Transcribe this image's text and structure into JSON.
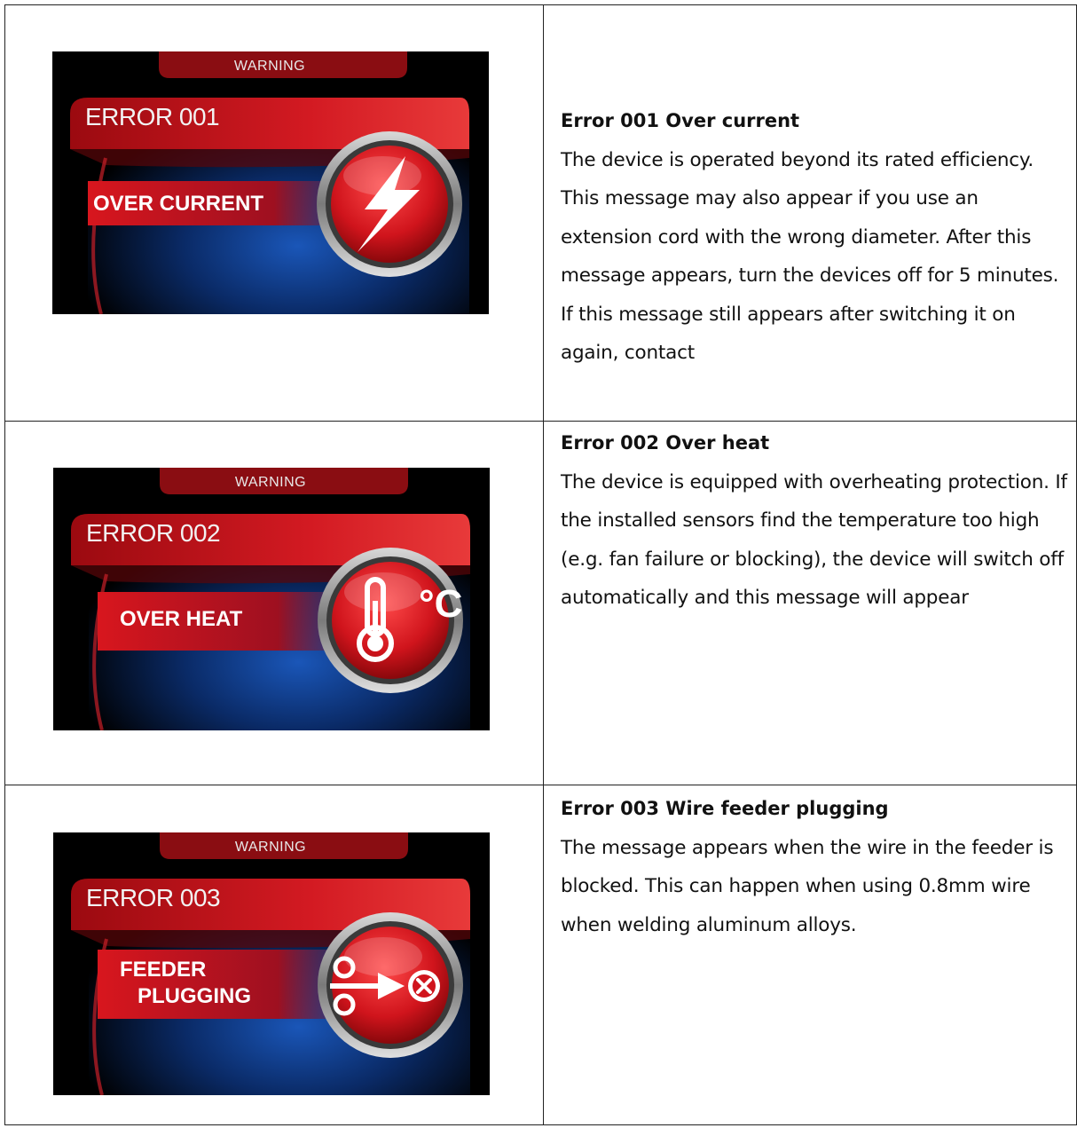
{
  "errors": [
    {
      "warning": "WARNING",
      "code": "ERROR 001",
      "name_lines": [
        "OVER CURRENT"
      ],
      "icon": "lightning-bolt-icon",
      "title": "Error 001 Over current",
      "description": "The device is operated beyond its rated efficiency. This message may also appear if you use an extension cord with the wrong diameter. After this message appears, turn the devices off for 5 minutes. If this message still appears after switching it on again, contact"
    },
    {
      "warning": "WARNING",
      "code": "ERROR 002",
      "name_lines": [
        "OVER HEAT"
      ],
      "icon": "thermometer-celsius-icon",
      "icon_text": "°C",
      "title": "Error 002 Over heat",
      "description": "The device is equipped with overheating protection. If the installed sensors find the temperature too high (e.g. fan failure or blocking), the device will switch off automatically and this message will appear"
    },
    {
      "warning": "WARNING",
      "code": "ERROR 003",
      "name_lines": [
        "FEEDER",
        "PLUGGING"
      ],
      "icon": "feeder-blocked-icon",
      "title": "Error 003 Wire feeder plugging",
      "description": "The message appears when the wire in the feeder is blocked. This can happen when using 0.8mm wire when welding aluminum alloys."
    }
  ],
  "colors": {
    "accent_red": "#d0141c",
    "dark_blue": "#0a2a66",
    "background": "#000000"
  }
}
